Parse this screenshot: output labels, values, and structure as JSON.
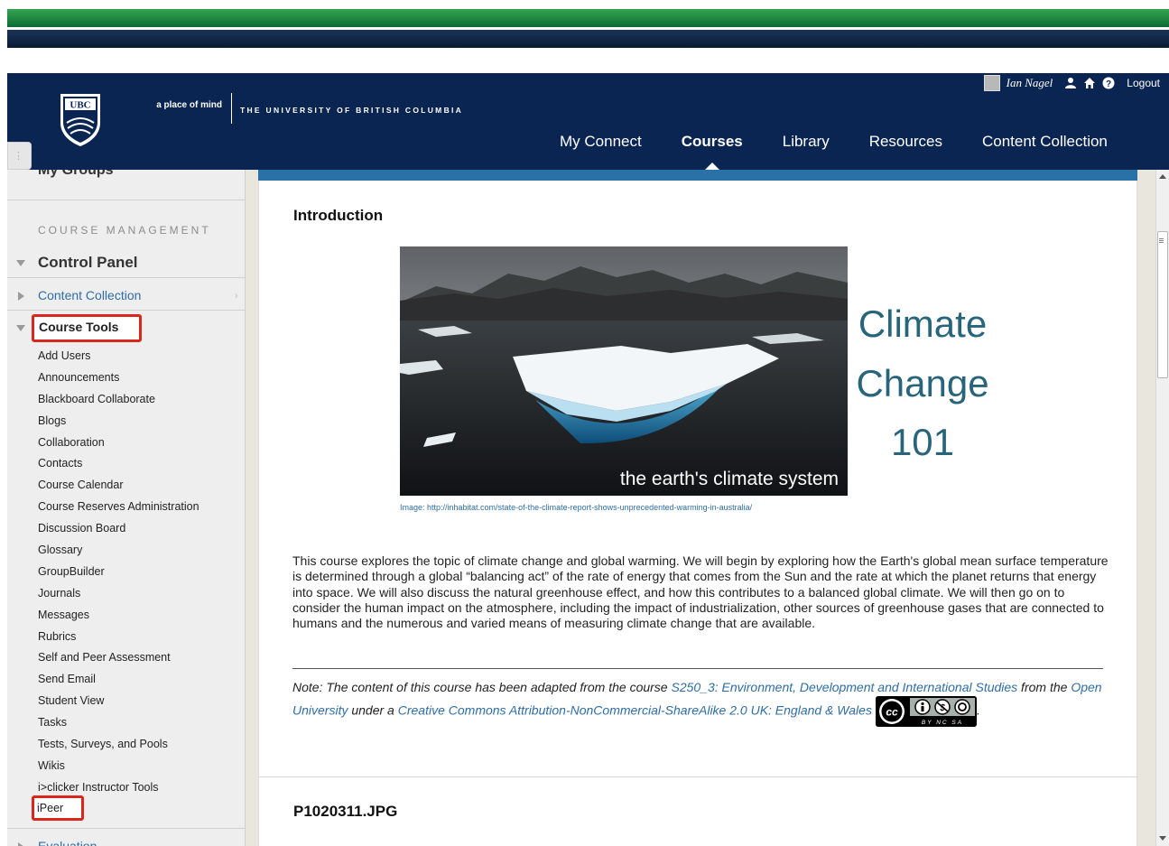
{
  "header": {
    "tagline": "a place of mind",
    "university": "THE UNIVERSITY OF BRITISH COLUMBIA",
    "logo_text": "UBC",
    "user_name": "Ian Nagel",
    "logout": "Logout",
    "nav": [
      {
        "label": "My Connect",
        "active": false
      },
      {
        "label": "Courses",
        "active": true
      },
      {
        "label": "Library",
        "active": false
      },
      {
        "label": "Resources",
        "active": false
      },
      {
        "label": "Content Collection",
        "active": false
      }
    ]
  },
  "sidebar": {
    "partial_top_item": "My Groups",
    "course_management_heading": "COURSE MANAGEMENT",
    "control_panel": "Control Panel",
    "content_collection": "Content Collection",
    "course_tools": "Course Tools",
    "tools": [
      "Add Users",
      "Announcements",
      "Blackboard Collaborate",
      "Blogs",
      "Collaboration",
      "Contacts",
      "Course Calendar",
      "Course Reserves Administration",
      "Discussion Board",
      "Glossary",
      "GroupBuilder",
      "Journals",
      "Messages",
      "Rubrics",
      "Self and Peer Assessment",
      "Send Email",
      "Student View",
      "Tasks",
      "Tests, Surveys, and Pools",
      "Wikis",
      "i>clicker Instructor Tools"
    ],
    "ipeer": "iPeer",
    "partial_bottom_item": "Evaluation"
  },
  "content": {
    "intro_title": "Introduction",
    "image_caption": "the earth's climate system",
    "course_title_lines": [
      "Climate",
      "Change",
      "101"
    ],
    "image_credit": "Image: http://inhabitat.com/state-of-the-climate-report-shows-unprecedented-warming-in-australia/",
    "description": "This course explores the topic of climate change and global warming. We will begin by exploring how the Earth's global mean surface temperature is determined through a global “balancing act” of the rate of energy that comes from the Sun and the rate at which the planet returns that energy into space. We will also discuss the natural greenhouse effect, and how this contributes to a balanced global climate. We will then go on to consider the human impact on the atmosphere, including the impact of industrialization, other sources of greenhouse gases that are connected to humans and the numerous and varied means of measuring climate change that are available.",
    "note": {
      "prefix": "Note: The content of this course has been adapted from the course ",
      "course_link": "S250_3: Environment, Development and International Studies",
      "middle1": " from the ",
      "ou_link": "Open University",
      "middle2": " under a ",
      "license_link": "Creative Commons Attribution-NonCommercial-ShareAlike 2.0 UK: England & Wales",
      "suffix": "."
    },
    "cc_badge_text": "BY NC SA",
    "file_title": "P1020311.JPG"
  },
  "colors": {
    "header_bg": "#0b2552",
    "link": "#2f6da5",
    "highlight_box": "#d9271d",
    "climate_title": "#28657a"
  }
}
